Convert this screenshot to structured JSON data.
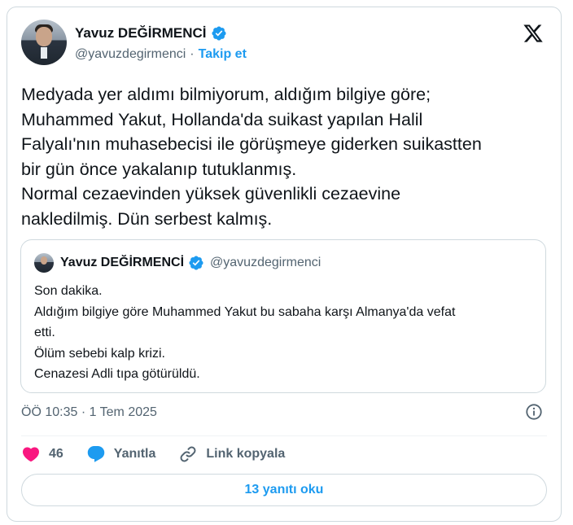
{
  "author": {
    "name": "Yavuz DEĞİRMENCİ",
    "handle": "@yavuzdegirmenci",
    "separator": "·",
    "follow_label": "Takip et"
  },
  "tweet": {
    "text": "Medyada yer aldımı bilmiyorum, aldığım bilgiye göre;\nMuhammed Yakut, Hollanda'da suikast yapılan Halil\nFalyalı'nın muhasebecisi ile görüşmeye giderken suikastten\nbir gün önce yakalanıp tutuklanmış.\nNormal cezaevinden yüksek güvenlikli cezaevine\nnakledilmiş. Dün serbest kalmış.",
    "timestamp": "ÖÖ 10:35 · 1 Tem 2025"
  },
  "quote": {
    "name": "Yavuz DEĞİRMENCİ",
    "handle": "@yavuzdegirmenci",
    "text": "Son dakika.\nAldığım bilgiye göre Muhammed Yakut bu sabaha karşı Almanya'da vefat\netti.\nÖlüm sebebi kalp krizi.\nCenazesi Adli tıpa götürüldü."
  },
  "actions": {
    "like_count": "46",
    "reply_label": "Yanıtla",
    "copy_link_label": "Link kopyala"
  },
  "read_replies_label": "13 yanıtı oku",
  "colors": {
    "accent": "#1d9bf0",
    "like": "#f91880",
    "text": "#0f1419",
    "muted": "#536471",
    "border": "#cfd9de"
  },
  "icons": [
    "verified-badge-icon",
    "x-logo-icon",
    "info-icon",
    "heart-icon",
    "reply-bubble-icon",
    "link-icon"
  ]
}
